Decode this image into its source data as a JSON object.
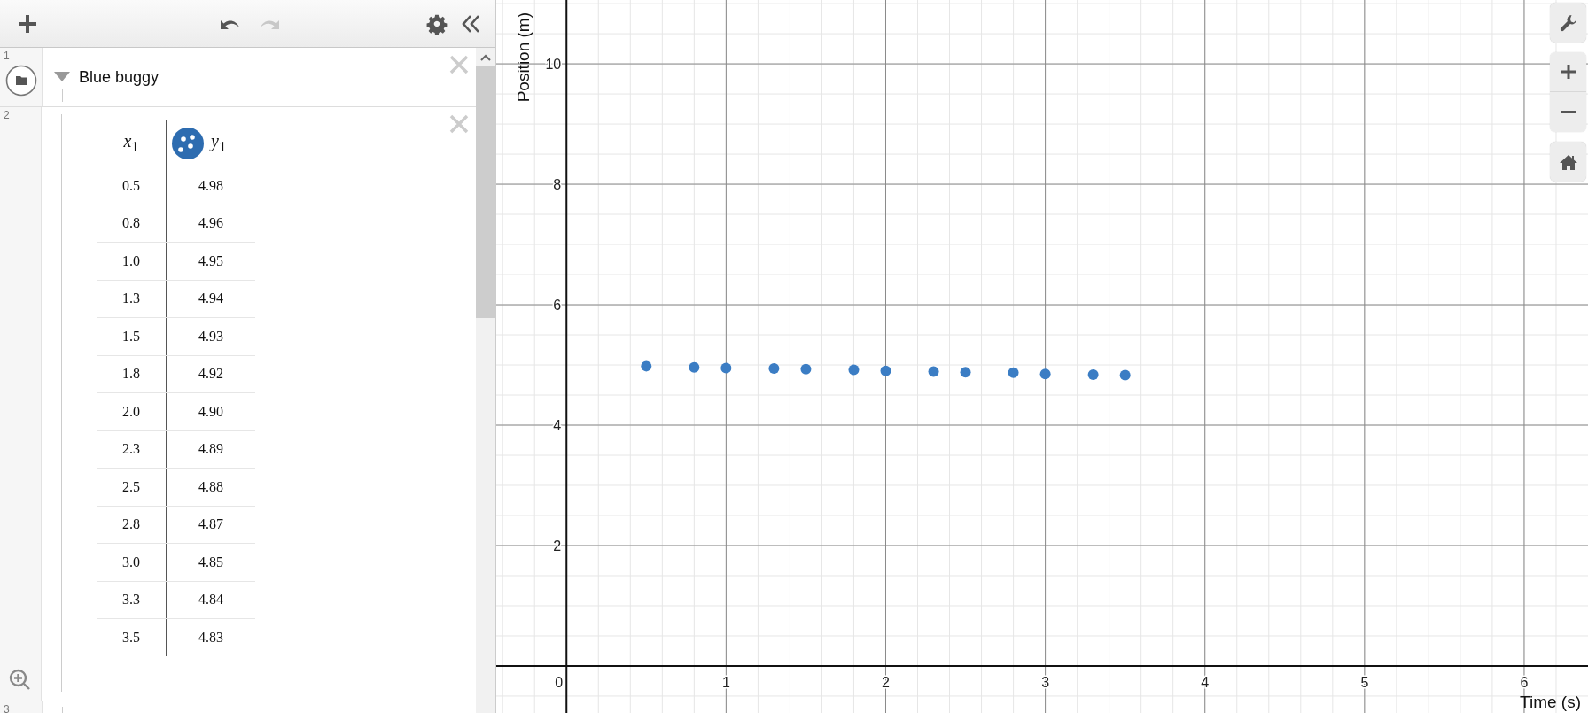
{
  "toolbar": {
    "undo_disabled": false,
    "redo_disabled": true
  },
  "expressions": [
    {
      "number": "1",
      "kind": "folder",
      "title": "Blue buggy",
      "expanded": true
    },
    {
      "number": "2",
      "kind": "table",
      "columns": [
        "*x*$_{1}$",
        "*y*$_{1}$"
      ],
      "rows": [
        [
          "0.5",
          "4.98"
        ],
        [
          "0.8",
          "4.96"
        ],
        [
          "1.0",
          "4.95"
        ],
        [
          "1.3",
          "4.94"
        ],
        [
          "1.5",
          "4.93"
        ],
        [
          "1.8",
          "4.92"
        ],
        [
          "2.0",
          "4.90"
        ],
        [
          "2.3",
          "4.89"
        ],
        [
          "2.5",
          "4.88"
        ],
        [
          "2.8",
          "4.87"
        ],
        [
          "3.0",
          "4.85"
        ],
        [
          "3.3",
          "4.84"
        ],
        [
          "3.5",
          "4.83"
        ]
      ]
    },
    {
      "number": "3",
      "kind": "empty"
    }
  ],
  "graph": {
    "chart_data": {
      "type": "scatter",
      "xlabel": "Time (s)",
      "ylabel": "Position (m)",
      "xlim": [
        -0.44,
        6.4
      ],
      "ylim": [
        -0.78,
        11.06
      ],
      "grid": true,
      "xticks": [
        0,
        1,
        2,
        3,
        4,
        5,
        6
      ],
      "yticks": [
        2,
        4,
        6,
        8,
        10
      ],
      "x": [
        0.5,
        0.8,
        1.0,
        1.3,
        1.5,
        1.8,
        2.0,
        2.3,
        2.5,
        2.8,
        3.0,
        3.3,
        3.5
      ],
      "series": [
        {
          "color": "#3b7dc4",
          "values": [
            4.98,
            4.96,
            4.95,
            4.94,
            4.93,
            4.92,
            4.9,
            4.89,
            4.88,
            4.87,
            4.85,
            4.84,
            4.83
          ]
        }
      ]
    }
  }
}
